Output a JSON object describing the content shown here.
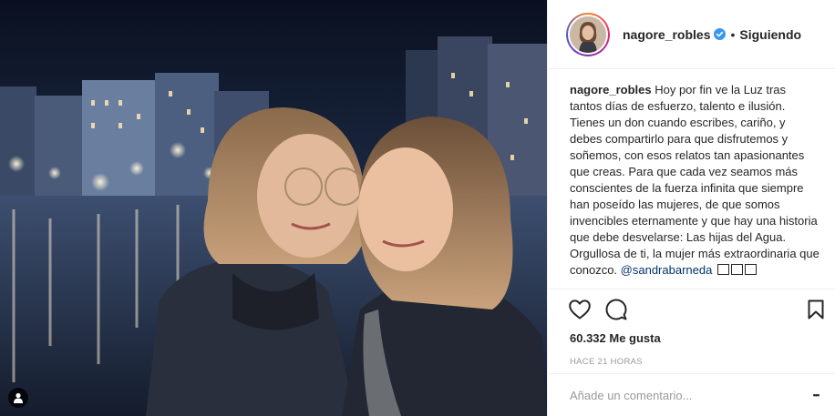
{
  "post": {
    "username": "nagore_robles",
    "follow_dot": "•",
    "follow_status": "Siguiendo",
    "caption_user": "nagore_robles",
    "caption_text": "Hoy por fin ve la Luz tras tantos días de esfuerzo, talento e ilusión. Tienes un don cuando escribes, cariño, y debes compartirlo para que disfrutemos y soñemos, con esos relatos tan apasionantes que creas. Para que cada vez seamos más conscientes de la fuerza infinita que siempre han poseído las mujeres, de que somos invencibles eternamente y que hay una historia que debe desvelarse: Las hijas del Agua. Orgullosa de ti, la mujer más extraordinaria que conozco.",
    "caption_mention": "@sandrabarneda",
    "likes": "60.332 Me gusta",
    "time_ago": "HACE 21 HORAS",
    "comment_placeholder": "Añade un comentario...",
    "more_glyph": "•••"
  },
  "icons": {
    "verified": "verified-badge-icon",
    "like": "heart-icon",
    "comment": "comment-bubble-icon",
    "save": "bookmark-icon",
    "tag": "user-tag-icon",
    "more": "more-options-icon"
  },
  "colors": {
    "verified_blue": "#3897f0",
    "mention": "#003569",
    "muted": "#999999",
    "text": "#262626"
  }
}
